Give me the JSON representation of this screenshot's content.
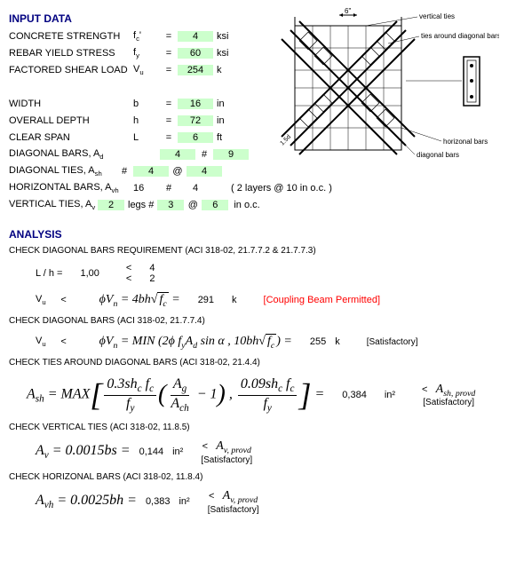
{
  "sections": {
    "input_title": "INPUT DATA",
    "analysis_title": "ANALYSIS"
  },
  "inputs": {
    "concrete_strength": {
      "label": "CONCRETE STRENGTH",
      "sym": "f",
      "sub": "c",
      "prime": "'",
      "val": "4",
      "unit": "ksi"
    },
    "rebar_yield": {
      "label": "REBAR YIELD STRESS",
      "sym": "f",
      "sub": "y",
      "val": "60",
      "unit": "ksi"
    },
    "factored_shear": {
      "label": "FACTORED SHEAR LOAD",
      "sym": "V",
      "sub": "u",
      "val": "254",
      "unit": "k"
    },
    "width": {
      "label": "WIDTH",
      "sym": "b",
      "val": "16",
      "unit": "in"
    },
    "overall_depth": {
      "label": "OVERALL DEPTH",
      "sym": "h",
      "val": "72",
      "unit": "in"
    },
    "clear_span": {
      "label": "CLEAR SPAN",
      "sym": "L",
      "val": "6",
      "unit": "ft"
    },
    "diag_bars": {
      "label": "DIAGONAL BARS, A",
      "sub": "d",
      "count": "4",
      "hash": "#",
      "size": "9"
    },
    "diag_ties": {
      "label": "DIAGONAL TIES, A",
      "sub": "sh",
      "hash": "#",
      "size": "4",
      "at": "@",
      "spacing": "4"
    },
    "horiz_bars": {
      "label": "HORIZONTAL BARS, A",
      "sub": "vh",
      "count": "16",
      "hash": "#",
      "size": "4",
      "note": "( 2 layers @ 10 in o.c. )"
    },
    "vert_ties": {
      "label": "VERTICAL TIES, A",
      "sub": "v",
      "legs_n": "2",
      "legs_txt": "legs #",
      "size": "3",
      "at": "@",
      "spacing": "6",
      "note": "in o.c."
    }
  },
  "diagram": {
    "top_dim": "6\"",
    "left_dim": "1.5d",
    "labels": {
      "vertical_ties": "vertical ties",
      "ties_around": "ties around diagonal bars",
      "horizontal_bars": "horizonal bars",
      "diagonal_bars": "diagonal bars"
    }
  },
  "analysis": {
    "check1": {
      "title": "CHECK DIAGONAL BARS REQUIREMENT (ACI 318-02, 21.7.7.2 & 21.7.7.3)",
      "lh_label": "L / h =",
      "lh_val": "1,00",
      "lt": "<",
      "lim1": "4",
      "lim2": "2",
      "vu": "V",
      "vu_sub": "u",
      "formula_prefix": "ϕV",
      "formula_n": "n",
      "formula_txt": " = 4bh",
      "sqrt_inner": "f",
      "sqrt_sub": "c",
      "eq": " = ",
      "result": "291",
      "unit": "k",
      "note": "[Coupling Beam Permitted]"
    },
    "check2": {
      "title": "CHECK DIAGONAL BARS (ACI 318-02, 21.7.7.4)",
      "vu": "V",
      "vu_sub": "u",
      "lt": "<",
      "formula": "ϕV",
      "n": "n",
      "min_txt": " = MIN (2ϕ f",
      "y": "y",
      "ad": "A",
      "d": "d",
      "sin": " sin α   ,   10bh",
      "sqrt_inner": "f",
      "sqrt_sub": "c",
      "close": ") = ",
      "result": "255",
      "unit": "k",
      "note": "[Satisfactory]"
    },
    "check3": {
      "title": "CHECK TIES AROUND DIAGONAL BARS (ACI 318-02, 21.4.4)",
      "lhs": "A",
      "lhs_sub": "sh",
      "max": " = MAX",
      "num1a": "0.3sh",
      "num1b": "c",
      "num1c": " f",
      "num1d": "c",
      "den1": "f",
      "den1_sub": "y",
      "inner_num": "A",
      "inner_num_sub": "g",
      "inner_den": "A",
      "inner_den_sub": "ch",
      "minus1": " − 1",
      "comma": "   ,   ",
      "num2a": "0.09sh",
      "num2b": "c",
      "num2c": " f",
      "num2d": "c",
      "den2": "f",
      "den2_sub": "y",
      "eq": " = ",
      "result": "0,384",
      "unit": "in²",
      "lt": "<",
      "rhs": "A",
      "rhs_sub": "sh, provd",
      "note": "[Satisfactory]"
    },
    "check4": {
      "title": "CHECK VERTICAL TIES (ACI 318-02, 11.8.5)",
      "lhs": "A",
      "lhs_sub": "v",
      "formula": " = 0.0015bs = ",
      "result": "0,144",
      "unit": "in²",
      "lt": "<",
      "rhs": "A",
      "rhs_sub": "v, provd",
      "note": "[Satisfactory]"
    },
    "check5": {
      "title": "CHECK HORIZONAL BARS (ACI 318-02, 11.8.4)",
      "lhs": "A",
      "lhs_sub": "vh",
      "formula": " = 0.0025bh = ",
      "result": "0,383",
      "unit": "in²",
      "lt": "<",
      "rhs": "A",
      "rhs_sub": "v, provd",
      "note": "[Satisfactory]"
    }
  }
}
